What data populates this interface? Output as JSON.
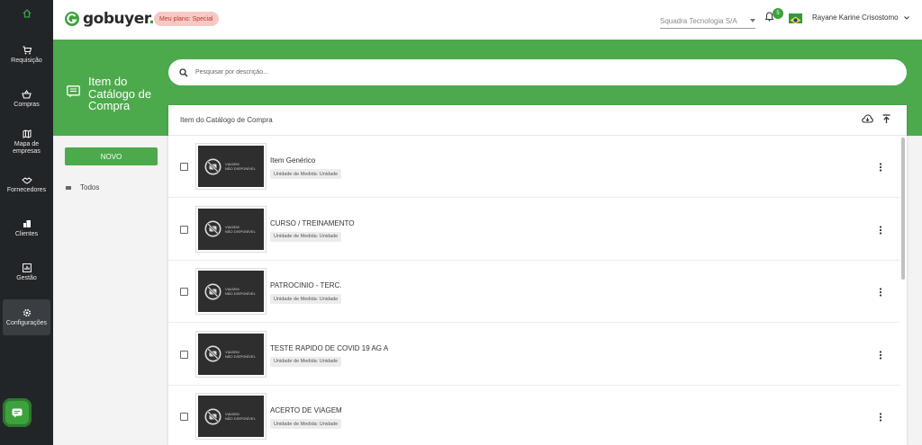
{
  "sidebar": {
    "items": [
      {
        "label": "Requisição",
        "icon": "cart-icon"
      },
      {
        "label": "Compras",
        "icon": "basket-icon"
      },
      {
        "label": "Mapa de empresas",
        "icon": "map-icon"
      },
      {
        "label": "Fornecedores",
        "icon": "handshake-icon"
      },
      {
        "label": "Clientes",
        "icon": "building-icon"
      },
      {
        "label": "Gestão",
        "icon": "chart-icon"
      },
      {
        "label": "Configurações",
        "icon": "gear-icon"
      }
    ],
    "active": "Configurações"
  },
  "topbar": {
    "logo": "gobuyer",
    "plan_badge": "Meu plano: Special",
    "company": "Squadra Tecnologia S/A",
    "notifications": "5",
    "user": "Rayane Karine Crisostomo"
  },
  "page": {
    "title": "Item do Catálogo de Compra",
    "search_placeholder": "Pesquisar por descrição..."
  },
  "left_panel": {
    "new_button": "NOVO",
    "filter_all": "Todos"
  },
  "list": {
    "header": "Item do Catálogo de Compra",
    "thumb_line1": "VIAGEM",
    "thumb_line2": "NÃO DISPONÍVEL",
    "items": [
      {
        "name": "Item Genérico",
        "uom": "Unidade de Medida: Unidade"
      },
      {
        "name": "CURSO / TREINAMENTO",
        "uom": "Unidade de Medida: Unidade"
      },
      {
        "name": "PATROCINIO - TERC.",
        "uom": "Unidade de Medida: Unidade"
      },
      {
        "name": "TESTE RAPIDO DE COVID 19 AG A",
        "uom": "Unidade de Medida: Unidade"
      },
      {
        "name": "ACERTO DE VIAGEM",
        "uom": "Unidade de Medida: Unidade"
      }
    ]
  },
  "colors": {
    "brand_green": "#4caa4c",
    "sidebar_bg": "#222528",
    "plan_badge_bg": "#f7c9c4"
  }
}
